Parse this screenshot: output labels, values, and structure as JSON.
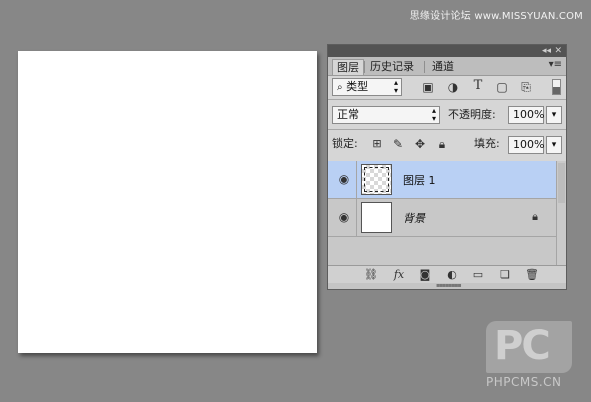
{
  "watermark_top": "思缘设计论坛 www.MISSYUAN.COM",
  "panel": {
    "topbar": {
      "collapse": "◂◂",
      "close": "✕"
    },
    "tabs": [
      {
        "label": "图层"
      },
      {
        "label": "历史记录"
      },
      {
        "label": "通道"
      }
    ],
    "panel_menu": "▾≡",
    "filter": {
      "label": "类型",
      "search_glyph": "⌕"
    },
    "filter_icons": [
      "image-filter-icon",
      "adjustment-filter-icon",
      "type-filter-icon",
      "shape-filter-icon",
      "smart-object-filter-icon"
    ],
    "blend_mode": {
      "value": "正常"
    },
    "opacity": {
      "label": "不透明度:",
      "value": "100%"
    },
    "lock": {
      "label": "锁定:"
    },
    "fill": {
      "label": "填充:",
      "value": "100%"
    },
    "layers": [
      {
        "name": "图层 1",
        "selected": true,
        "thumbnail": "transparent"
      },
      {
        "name": "背景",
        "selected": false,
        "thumbnail": "white",
        "locked": true
      }
    ]
  },
  "footer_icons": [
    "link-icon",
    "fx-icon",
    "mask-icon",
    "adjustment-icon",
    "folder-icon",
    "new-layer-icon",
    "trash-icon"
  ],
  "footer_fx_label": "fx",
  "logo": {
    "letters": "PC",
    "site": "PHPCMS.CN"
  }
}
